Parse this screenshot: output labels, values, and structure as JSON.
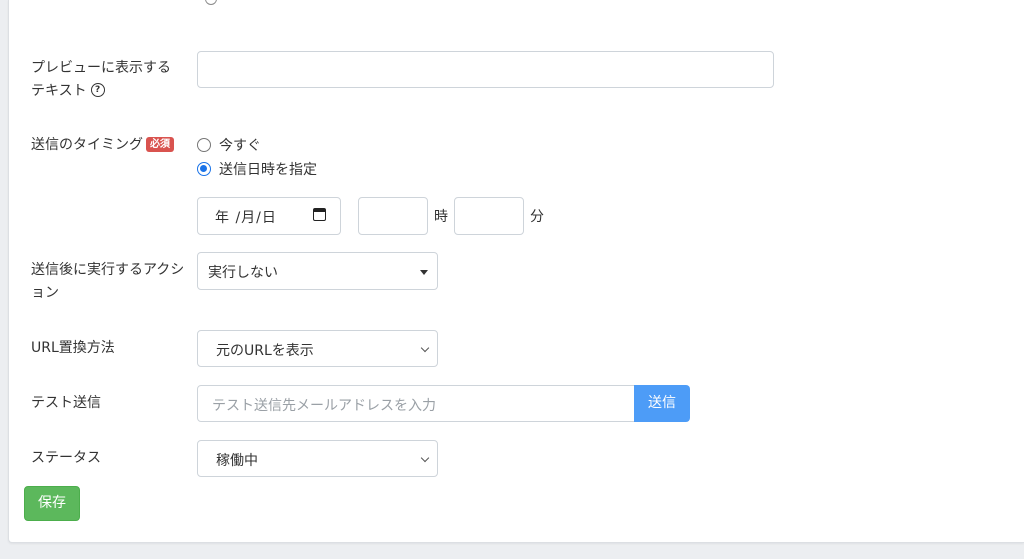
{
  "clipped_top_option": "",
  "preview": {
    "label_line1": "プレビューに表示する",
    "label_line2": "テキスト",
    "help_icon": "question-circle-icon",
    "value": ""
  },
  "timing": {
    "label": "送信のタイミング",
    "required_badge": "必須",
    "options": [
      {
        "label": "今すぐ",
        "checked": false
      },
      {
        "label": "送信日時を指定",
        "checked": true
      }
    ],
    "date_placeholder": "年 /月/日",
    "calendar_icon": "calendar-icon",
    "hour_value": "",
    "hour_unit": "時",
    "minute_value": "",
    "minute_unit": "分"
  },
  "after_action": {
    "label_line1": "送信後に実行するアクシ",
    "label_line2": "ョン",
    "selected": "実行しない"
  },
  "url_replace": {
    "label": "URL置換方法",
    "selected": "元のURLを表示"
  },
  "test_send": {
    "label": "テスト送信",
    "placeholder": "テスト送信先メールアドレスを入力",
    "button": "送信"
  },
  "status": {
    "label": "ステータス",
    "selected": "稼働中"
  },
  "save_button": "保存",
  "colors": {
    "primary": "#4d9cf7",
    "success": "#5cb85c",
    "danger_badge": "#d9534f",
    "radio_checked": "#1a73e8"
  }
}
